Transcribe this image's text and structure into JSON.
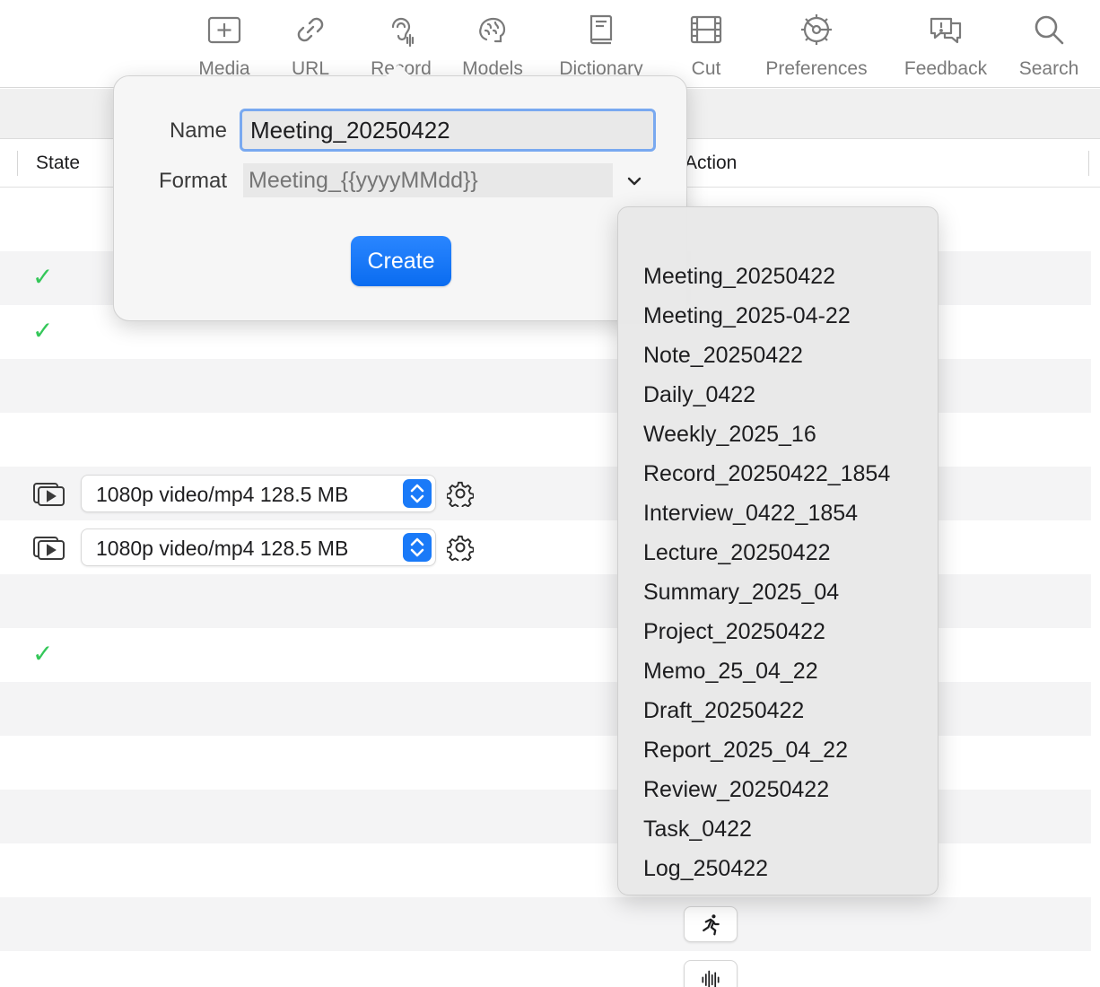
{
  "toolbar": {
    "items": [
      {
        "label": "Media",
        "icon": "add-media-icon"
      },
      {
        "label": "URL",
        "icon": "link-icon"
      },
      {
        "label": "Record",
        "icon": "ear-icon"
      },
      {
        "label": "Models",
        "icon": "brain-icon"
      },
      {
        "label": "Dictionary",
        "icon": "book-icon"
      },
      {
        "label": "Cut",
        "icon": "film-icon"
      },
      {
        "label": "Preferences",
        "icon": "gear-icon"
      },
      {
        "label": "Feedback",
        "icon": "feedback-icon"
      },
      {
        "label": "Search",
        "icon": "search-icon"
      }
    ]
  },
  "table": {
    "columns": {
      "state": "State",
      "action": "Action"
    },
    "rows": [
      {
        "state": "check"
      },
      {
        "state": "check"
      },
      {
        "media": {
          "format": "1080p video/mp4 128.5 MB"
        }
      },
      {
        "media": {
          "format": "1080p video/mp4 128.5 MB"
        }
      },
      {
        "state": "check"
      }
    ],
    "check_glyph": "✓"
  },
  "popover": {
    "name_label": "Name",
    "name_value": "Meeting_20250422",
    "format_label": "Format",
    "format_placeholder": "Meeting_{{yyyyMMdd}}",
    "create_label": "Create"
  },
  "format_menu": {
    "items": [
      "Meeting_20250422",
      "Meeting_2025-04-22",
      "Note_20250422",
      "Daily_0422",
      "Weekly_2025_16",
      "Record_20250422_1854",
      "Interview_0422_1854",
      "Lecture_20250422",
      "Summary_2025_04",
      "Project_20250422",
      "Memo_25_04_22",
      "Draft_20250422",
      "Report_2025_04_22",
      "Review_20250422",
      "Task_0422",
      "Log_250422"
    ]
  },
  "colors": {
    "accent": "#1a7af8",
    "check": "#34c759",
    "focus_ring": "#79a9f0",
    "row_alt": "#f4f4f5"
  }
}
